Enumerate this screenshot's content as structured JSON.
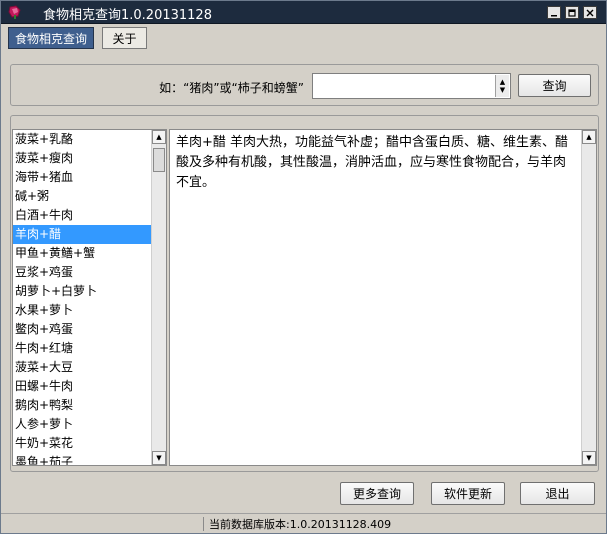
{
  "window": {
    "title": "食物相克查询1.0.20131128",
    "app_icon": "rose-icon",
    "controls": [
      "minimize-icon",
      "maximize-icon",
      "close-icon"
    ]
  },
  "tabs": [
    {
      "label": "食物相克查询",
      "active": true
    },
    {
      "label": "关于",
      "active": false
    }
  ],
  "search": {
    "hint": "如：“猪肉”或“柿子和螃蟹”",
    "value": "",
    "button": "查询"
  },
  "list": {
    "items": [
      "菠菜+乳酪",
      "菠菜+瘦肉",
      "海带+猪血",
      "碱+粥",
      "白酒+牛肉",
      "羊肉+醋",
      "甲鱼+黄鳝+蟹",
      "豆浆+鸡蛋",
      "胡萝卜+白萝卜",
      "水果+萝卜",
      "鳖肉+鸡蛋",
      "牛肉+红塘",
      "菠菜+大豆",
      "田螺+牛肉",
      "鹅肉+鸭梨",
      "人参+萝卜",
      "牛奶+菜花",
      "墨鱼+茄子"
    ],
    "selected_index": 5
  },
  "detail": {
    "text": "羊肉+醋 羊肉大热，功能益气补虚；醋中含蛋白质、糖、维生素、醋酸及多种有机酸，其性酸温，消肿活血，应与寒性食物配合，与羊肉不宜。"
  },
  "buttons": {
    "more": "更多查询",
    "update": "软件更新",
    "exit": "退出"
  },
  "status": {
    "version": "当前数据库版本:1.0.20131128.409"
  },
  "colors": {
    "titlebar": "#1d2b3e",
    "active_tab": "#3f5f8e",
    "selection": "#3399ff",
    "window_bg": "#d4d0c8"
  }
}
